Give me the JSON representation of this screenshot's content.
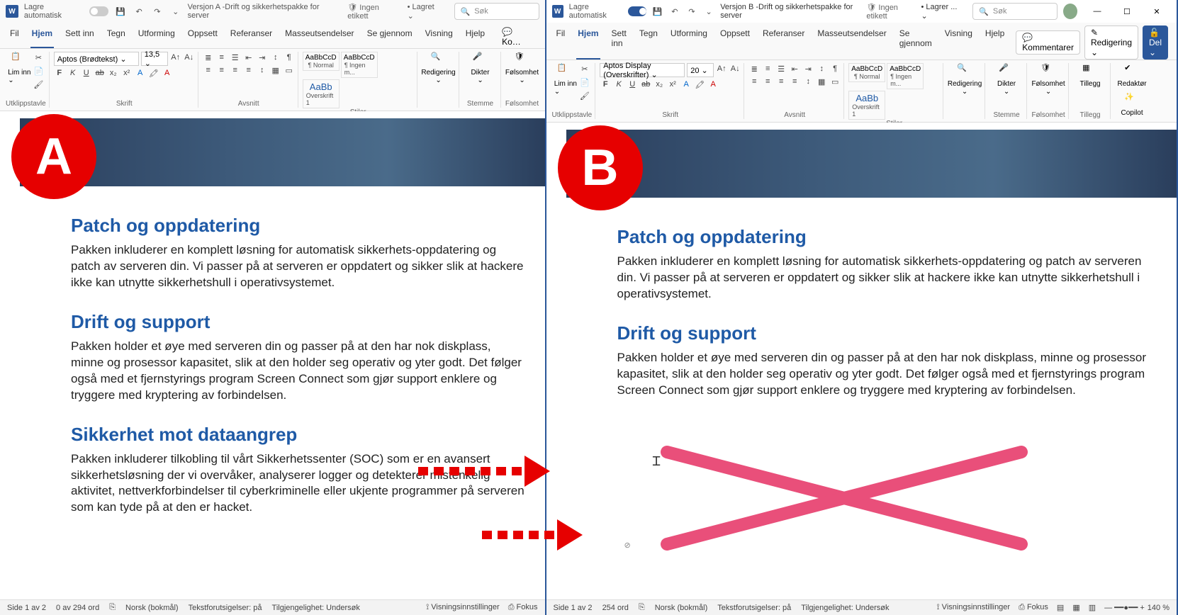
{
  "windows": [
    {
      "id": "A",
      "active": false,
      "autosave_label": "Lagre automatisk",
      "autosave_on": false,
      "doc_title": "Versjon A -Drift og sikkerhetspakke for server",
      "sensitivity": "Ingen etikett",
      "saved_status": "Lagret",
      "search_placeholder": "Søk",
      "font_name": "Aptos (Brødtekst)",
      "font_size": "13,5",
      "status": {
        "page": "Side 1 av 2",
        "words": "0 av 294 ord",
        "lang": "Norsk (bokmål)",
        "predict": "Tekstforutsigelser: på",
        "access": "Tilgjengelighet: Undersøk",
        "display": "Visningsinnstillinger",
        "focus": "Fokus"
      },
      "show_section3": true
    },
    {
      "id": "B",
      "active": true,
      "autosave_label": "Lagre automatisk",
      "autosave_on": true,
      "doc_title": "Versjon B -Drift og sikkerhetspakke for server",
      "sensitivity": "Ingen etikett",
      "saved_status": "Lagrer ...",
      "search_placeholder": "Søk",
      "font_name": "Aptos Display (Overskrifter)",
      "font_size": "20",
      "status": {
        "page": "Side 1 av 2",
        "words": "254 ord",
        "lang": "Norsk (bokmål)",
        "predict": "Tekstforutsigelser: på",
        "access": "Tilgjengelighet: Undersøk",
        "display": "Visningsinnstillinger",
        "focus": "Fokus",
        "zoom": "140 %"
      },
      "show_section3": false
    }
  ],
  "tabs": [
    "Fil",
    "Hjem",
    "Sett inn",
    "Tegn",
    "Utforming",
    "Oppsett",
    "Referanser",
    "Masseutsendelser",
    "Se gjennom",
    "Visning",
    "Hjelp"
  ],
  "ribbon_right": {
    "comments": "Kommentarer",
    "editing": "Redigering",
    "share": "Del"
  },
  "ribbon": {
    "clipboard": {
      "paste": "Lim inn",
      "label": "Utklippstavle"
    },
    "font_label": "Skrift",
    "para_label": "Avsnitt",
    "styles": {
      "normal_preview": "AaBbCcD",
      "normal": "Normal",
      "nospace_preview": "AaBbCcD",
      "nospace": "Ingen m...",
      "h1_preview": "AaBb",
      "h1": "Overskrift 1",
      "label": "Stiler"
    },
    "editing": "Redigering",
    "dictate": "Dikter",
    "voice": "Stemme",
    "sens": "Følsomhet",
    "addins": "Tillegg",
    "editor": "Redaktør",
    "copilot": "Copilot"
  },
  "body": {
    "h1": "Patch og oppdatering",
    "p1": "Pakken inkluderer en komplett løsning for automatisk sikkerhets-oppdatering og patch av serveren din. Vi passer på at serveren er oppdatert og sikker slik at hackere ikke kan utnytte sikkerhetshull i operativsystemet.",
    "h2": "Drift og support",
    "p2": "Pakken holder et øye med serveren din og passer på at den har nok diskplass, minne og prosessor kapasitet, slik at den holder seg operativ og yter godt. Det følger også med et fjernstyrings program Screen Connect som gjør support enklere og tryggere med kryptering av forbindelsen.",
    "h3": "Sikkerhet mot dataangrep",
    "p3": "Pakken inkluderer tilkobling til vårt Sikkerhetssenter (SOC) som er en avansert sikkerhetsløsning der vi overvåker, analyserer logger og detekterer mistenkelig aktivitet, nettverkforbindelser til cyberkriminelle eller ukjente programmer på serveren som kan tyde på at den er hacket."
  }
}
